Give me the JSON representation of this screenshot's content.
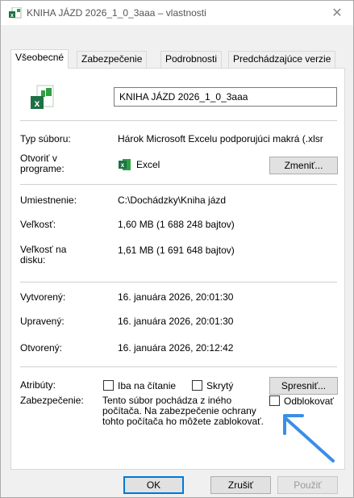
{
  "window": {
    "title": "KNIHA JÁZD 2026_1_0_3aaa – vlastnosti",
    "close_glyph": "✕"
  },
  "tabs": [
    {
      "label": "Všeobecné",
      "active": true
    },
    {
      "label": "Zabezpečenie",
      "active": false
    },
    {
      "label": "Podrobnosti",
      "active": false
    },
    {
      "label": "Predchádzajúce verzie",
      "active": false
    }
  ],
  "general": {
    "file_name": "KNIHA JÁZD 2026_1_0_3aaa",
    "file_type_label": "Typ súboru:",
    "file_type_value": "Hárok Microsoft Excelu podporujúci makrá (.xlsr",
    "opens_with_label_1": "Otvoriť v",
    "opens_with_label_2": "programe:",
    "opens_with_value": "Excel",
    "change_button": "Zmeniť...",
    "location_label": "Umiestnenie:",
    "location_value": "C:\\Dochádzky\\Kniha jázd",
    "size_label": "Veľkosť:",
    "size_value": "1,60 MB (1 688 248 bajtov)",
    "size_on_disk_label_1": "Veľkosť na",
    "size_on_disk_label_2": "disku:",
    "size_on_disk_value": "1,61 MB (1 691 648 bajtov)",
    "created_label": "Vytvorený:",
    "created_value": "16. januára 2026, 20:01:30",
    "modified_label": "Upravený:",
    "modified_value": "16. januára 2026, 20:01:30",
    "accessed_label": "Otvorený:",
    "accessed_value": "16. januára 2026, 20:12:42",
    "attributes_label": "Atribúty:",
    "readonly_label": "Iba na čítanie",
    "hidden_label": "Skrytý",
    "advanced_button": "Spresniť...",
    "security_label": "Zabezpečenie:",
    "security_text": "Tento súbor pochádza z iného počítača. Na zabezpečenie ochrany tohto počítača ho môžete zablokovať.",
    "unblock_label": "Odblokovať"
  },
  "buttons": {
    "ok": "OK",
    "cancel": "Zrušiť",
    "apply": "Použiť"
  },
  "colors": {
    "excel_green": "#1e7145",
    "arrow_blue": "#3a8ee6",
    "focus_blue": "#0078d7"
  },
  "icons": {
    "title": "excel-file-icon",
    "big": "excel-file-icon",
    "small": "excel-app-icon",
    "annotation": "arrow-annotation"
  }
}
